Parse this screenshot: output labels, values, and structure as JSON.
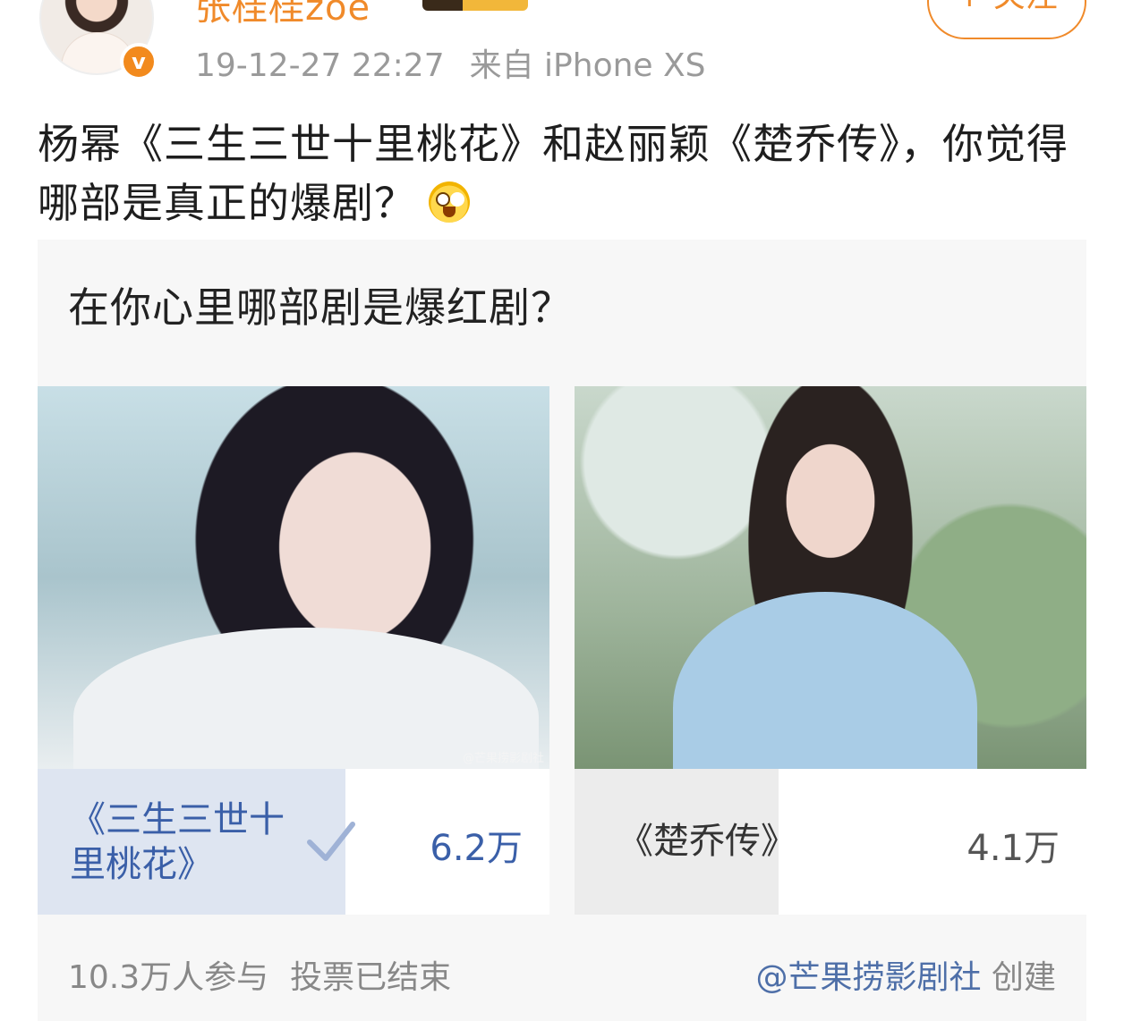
{
  "header": {
    "username": "张桂桂zoe",
    "timestamp": "19-12-27 22:27",
    "source": "来自 iPhone XS",
    "follow_label": "+ 关注",
    "verified_icon": "v-badge-icon"
  },
  "post": {
    "text": "杨幂《三生三世十里桃花》和赵丽颖《楚乔传》，你觉得哪部是真正的爆剧？"
  },
  "vote": {
    "question": "在你心里哪部剧是爆红剧？",
    "options": [
      {
        "label": "《三生三世十里桃花》",
        "votes": "6.2万",
        "share": 0.602,
        "selected": true,
        "watermark": "@芒果捞影剧社"
      },
      {
        "label": "《楚乔传》",
        "votes": "4.1万",
        "share": 0.398,
        "selected": false
      }
    ],
    "participants": "10.3万人参与",
    "status": "投票已结束",
    "creator": "@芒果捞影剧社",
    "creator_suffix": "创建",
    "colors": {
      "selected_fill": "#dee5f1",
      "unselected_fill": "#ececec",
      "accent": "#3a5fa8",
      "brand_orange": "#f08a2a"
    }
  }
}
